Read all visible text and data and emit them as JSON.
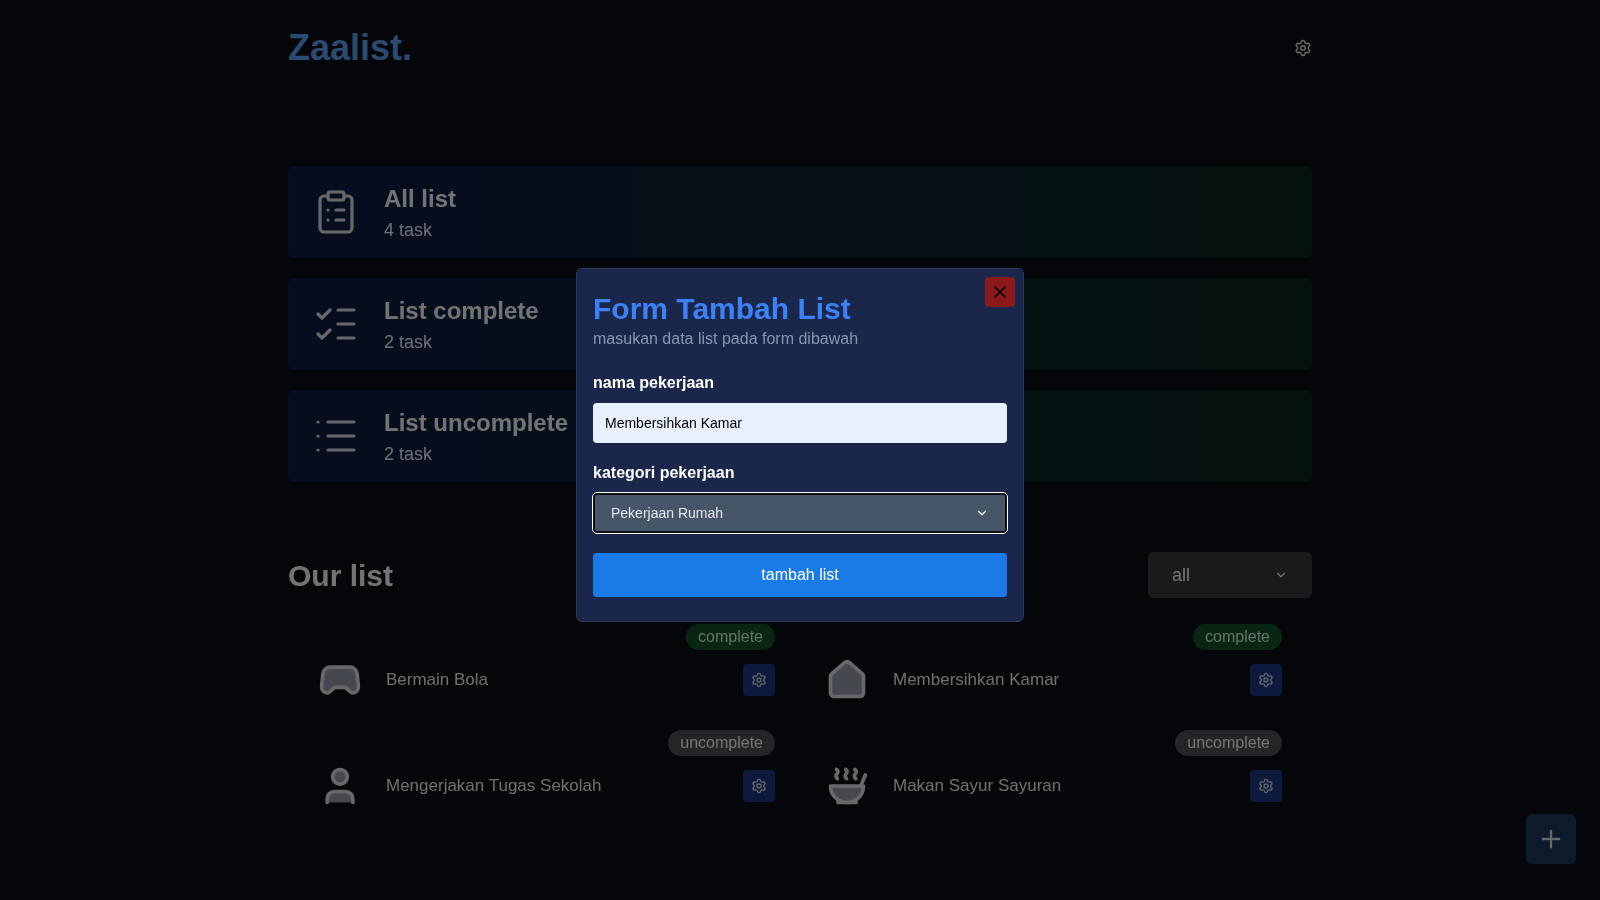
{
  "header": {
    "logo": "Zaalist."
  },
  "summary_cards": [
    {
      "kind": "all",
      "title": "All list",
      "count": "4 task"
    },
    {
      "kind": "complete",
      "title": "List complete",
      "count": "2 task"
    },
    {
      "kind": "uncomplete",
      "title": "List uncomplete",
      "count": "2 task"
    }
  ],
  "section": {
    "title": "Our list",
    "filter": "all"
  },
  "items": [
    {
      "kind": "game",
      "name": "Bermain Bola",
      "done": true,
      "badge": "complete"
    },
    {
      "kind": "home",
      "name": "Membersihkan Kamar",
      "done": true,
      "badge": "complete"
    },
    {
      "kind": "school",
      "name": "Mengerjakan Tugas Sekolah",
      "done": false,
      "badge": "uncomplete"
    },
    {
      "kind": "food",
      "name": "Makan Sayur Sayuran",
      "done": false,
      "badge": "uncomplete"
    }
  ],
  "modal": {
    "title": "Form Tambah List",
    "subtitle": "masukan data list pada form dibawah",
    "name_label": "nama pekerjaan",
    "name_value": "Membersihkan Kamar",
    "category_label": "kategori pekerjaan",
    "category_value": "Pekerjaan Rumah",
    "submit": "tambah list"
  }
}
